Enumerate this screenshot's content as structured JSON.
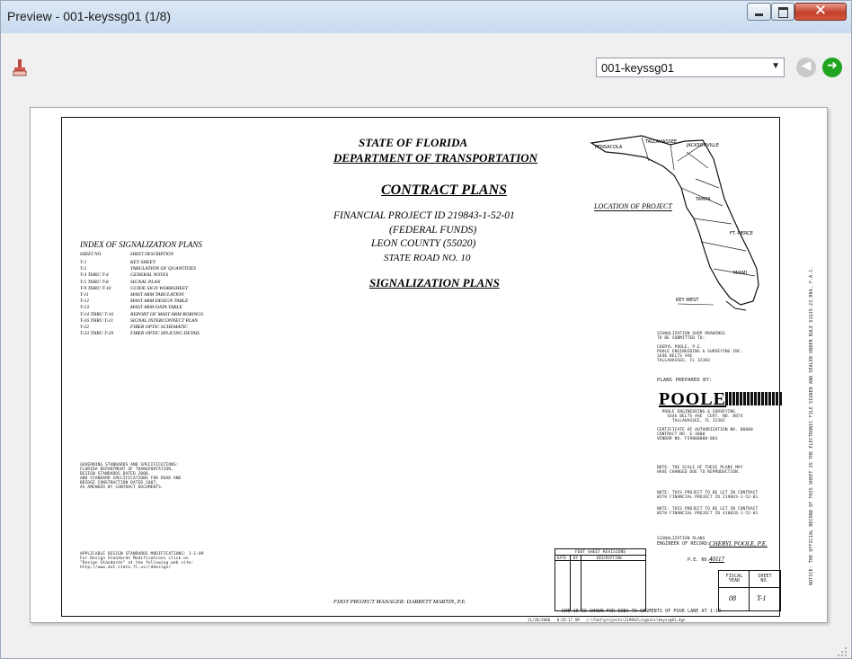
{
  "window": {
    "title": "Preview - 001-keyssg01  (1/8)",
    "close_glyph": "✕"
  },
  "toolbar": {
    "print_icon": "paintbrush-icon",
    "select_value": "001-keyssg01",
    "select_arrow": "▼",
    "back_glyph": "◀",
    "forward_glyph": "➜"
  },
  "sheet": {
    "state": "STATE OF FLORIDA",
    "department": "DEPARTMENT OF TRANSPORTATION",
    "contract": "CONTRACT PLANS",
    "financial_project": "FINANCIAL PROJECT ID 219843-1-52-01",
    "federal": "(FEDERAL FUNDS)",
    "county": "LEON COUNTY (55020)",
    "road": "STATE ROAD NO. 10",
    "signalization": "SIGNALIZATION PLANS",
    "location": "LOCATION OF PROJECT",
    "index_title": "INDEX OF SIGNALIZATION PLANS",
    "index_header": [
      "SHEET NO.",
      "SHEET DESCRIPTION"
    ],
    "index_rows": [
      [
        "T-1",
        "KEY SHEET"
      ],
      [
        "T-2",
        "TABULATION OF QUANTITIES"
      ],
      [
        "T-3 THRU T-4",
        "GENERAL NOTES"
      ],
      [
        "T-5 THRU T-8",
        "SIGNAL PLAN"
      ],
      [
        "T-9 THRU T-10",
        "GUIDE SIGN WORKSHEET"
      ],
      [
        "T-11",
        "MAST ARM TABULATION"
      ],
      [
        "T-12",
        "MAST ARM DESIGN TABLE"
      ],
      [
        "T-13",
        "MAST ARM DATA TABLE"
      ],
      [
        "T-14 THRU T-16",
        "REPORT OF MAST ARM BORINGS"
      ],
      [
        "T-16 THRU T-21",
        "SIGNAL INTERCONNECT PLAN"
      ],
      [
        "T-22",
        "FIBER OPTIC SCHEMATIC"
      ],
      [
        "T-23 THRU T-29",
        "FIBER OPTIC SPLICING DETAIL"
      ]
    ],
    "manager": "FDOT PROJECT MANAGER:  DARRETT MARTIN, P.E.",
    "scale_note": "SHE 10 IS SHOWN FOR IDEA TO SEGMENTS OF FOUR LANE AT 1:10",
    "revisions_title": "FDOT SHEET REVISIONS",
    "revisions_cols": [
      "DATE",
      "BY",
      "DESCRIPTION"
    ],
    "plans_prepared": "PLANS PREPARED BY:",
    "poole": "POOLE",
    "engineer_label": "ENGINEER OF RECORD:",
    "engineer_name": "CHERYL POOLE, P.E.",
    "pe_no": "P.E. NO.:",
    "pe_value": "40117",
    "fiscal_year": "FISCAL YEAR",
    "fiscal_value": "08",
    "sheet_no": "SHEET NO.",
    "sheet_value": "T-1"
  }
}
